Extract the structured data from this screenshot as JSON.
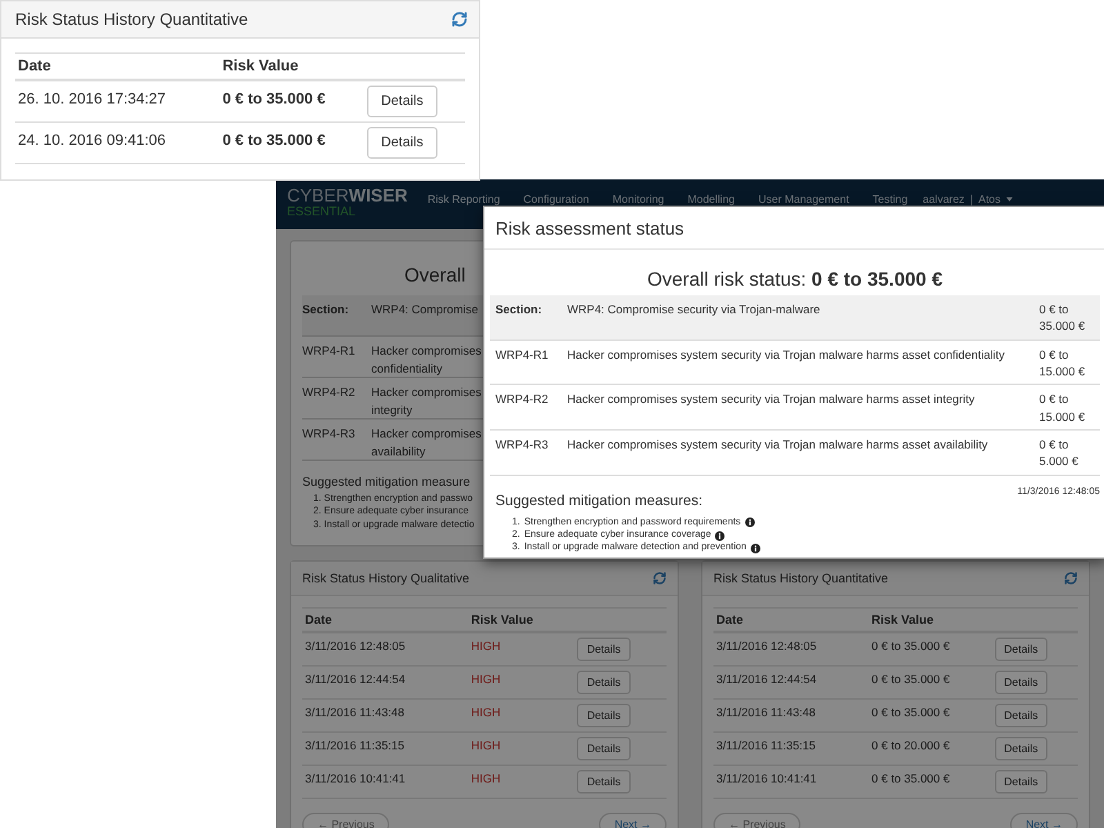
{
  "widget": {
    "title": "Risk Status History Quantitative",
    "columns": [
      "Date",
      "Risk Value"
    ],
    "rows": [
      {
        "date": "26. 10. 2016 17:34:27",
        "value": "0 € to 35.000 €",
        "action": "Details"
      },
      {
        "date": "24. 10. 2016 09:41:06",
        "value": "0 € to 35.000 €",
        "action": "Details"
      }
    ]
  },
  "app": {
    "logo": {
      "first": "CYBER",
      "second": "WISER",
      "sub": "ESSENTIAL"
    },
    "nav": [
      "Risk Reporting",
      "Configuration",
      "Monitoring",
      "Modelling",
      "User Management",
      "Testing"
    ],
    "user": "aalvarez",
    "separator": "|",
    "org": "Atos",
    "background_panel": {
      "title": "Overall",
      "section_label": "Section:",
      "section_text": "WRP4: Compromise",
      "rows": [
        {
          "id": "WRP4-R1",
          "lines": [
            "Hacker compromises",
            "confidentiality"
          ]
        },
        {
          "id": "WRP4-R2",
          "lines": [
            "Hacker compromises",
            "integrity"
          ]
        },
        {
          "id": "WRP4-R3",
          "lines": [
            "Hacker compromises",
            "availability"
          ]
        }
      ],
      "mitigation_title": "Suggested mitigation measure",
      "measures": [
        "1. Strengthen encryption and passwo",
        "2. Ensure adequate cyber insurance",
        "3. Install or upgrade malware detectio"
      ]
    },
    "history_panels": [
      {
        "kind": "qualitative",
        "title": "Risk Status History Qualitative",
        "columns": [
          "Date",
          "Risk Value"
        ],
        "rows": [
          {
            "date": "3/11/2016 12:48:05",
            "value": "HIGH",
            "action": "Details"
          },
          {
            "date": "3/11/2016 12:44:54",
            "value": "HIGH",
            "action": "Details"
          },
          {
            "date": "3/11/2016 11:43:48",
            "value": "HIGH",
            "action": "Details"
          },
          {
            "date": "3/11/2016 11:35:15",
            "value": "HIGH",
            "action": "Details"
          },
          {
            "date": "3/11/2016 10:41:41",
            "value": "HIGH",
            "action": "Details"
          }
        ],
        "previous": "← Previous",
        "next": "Next →"
      },
      {
        "kind": "quantitative",
        "title": "Risk Status History Quantitative",
        "columns": [
          "Date",
          "Risk Value"
        ],
        "rows": [
          {
            "date": "3/11/2016 12:48:05",
            "value": "0 € to 35.000 €",
            "action": "Details"
          },
          {
            "date": "3/11/2016 12:44:54",
            "value": "0 € to 35.000 €",
            "action": "Details"
          },
          {
            "date": "3/11/2016 11:43:48",
            "value": "0 € to 35.000 €",
            "action": "Details"
          },
          {
            "date": "3/11/2016 11:35:15",
            "value": "0 € to 20.000 €",
            "action": "Details"
          },
          {
            "date": "3/11/2016 10:41:41",
            "value": "0 € to 35.000 €",
            "action": "Details"
          }
        ],
        "previous": "← Previous",
        "next": "Next →"
      }
    ],
    "modal": {
      "title": "Risk assessment status",
      "overall": "Overall risk status: **0 € to 35.000 €**",
      "section": {
        "label": "Section:",
        "text": "WRP4: Compromise security via Trojan-malware",
        "value": "0 € to 35.000 €"
      },
      "rows": [
        {
          "id": "WRP4-R1",
          "text": "Hacker compromises system security via Trojan malware harms asset confidentiality",
          "value": "0 € to 15.000 €"
        },
        {
          "id": "WRP4-R2",
          "text": "Hacker compromises system security via Trojan malware harms asset integrity",
          "value": "0 € to 15.000 €"
        },
        {
          "id": "WRP4-R3",
          "text": "Hacker compromises system security via Trojan malware harms asset availability",
          "value": "0 € to 5.000 €"
        }
      ],
      "mitigation_title": "Suggested mitigation measures:",
      "timestamp": "11/3/2016 12:48:05",
      "measures": [
        {
          "number": "1.",
          "text": "Strengthen encryption and password requirements"
        },
        {
          "number": "2.",
          "text": "Ensure adequate cyber insurance coverage"
        },
        {
          "number": "3.",
          "text": "Install or upgrade malware detection and prevention"
        }
      ]
    }
  }
}
